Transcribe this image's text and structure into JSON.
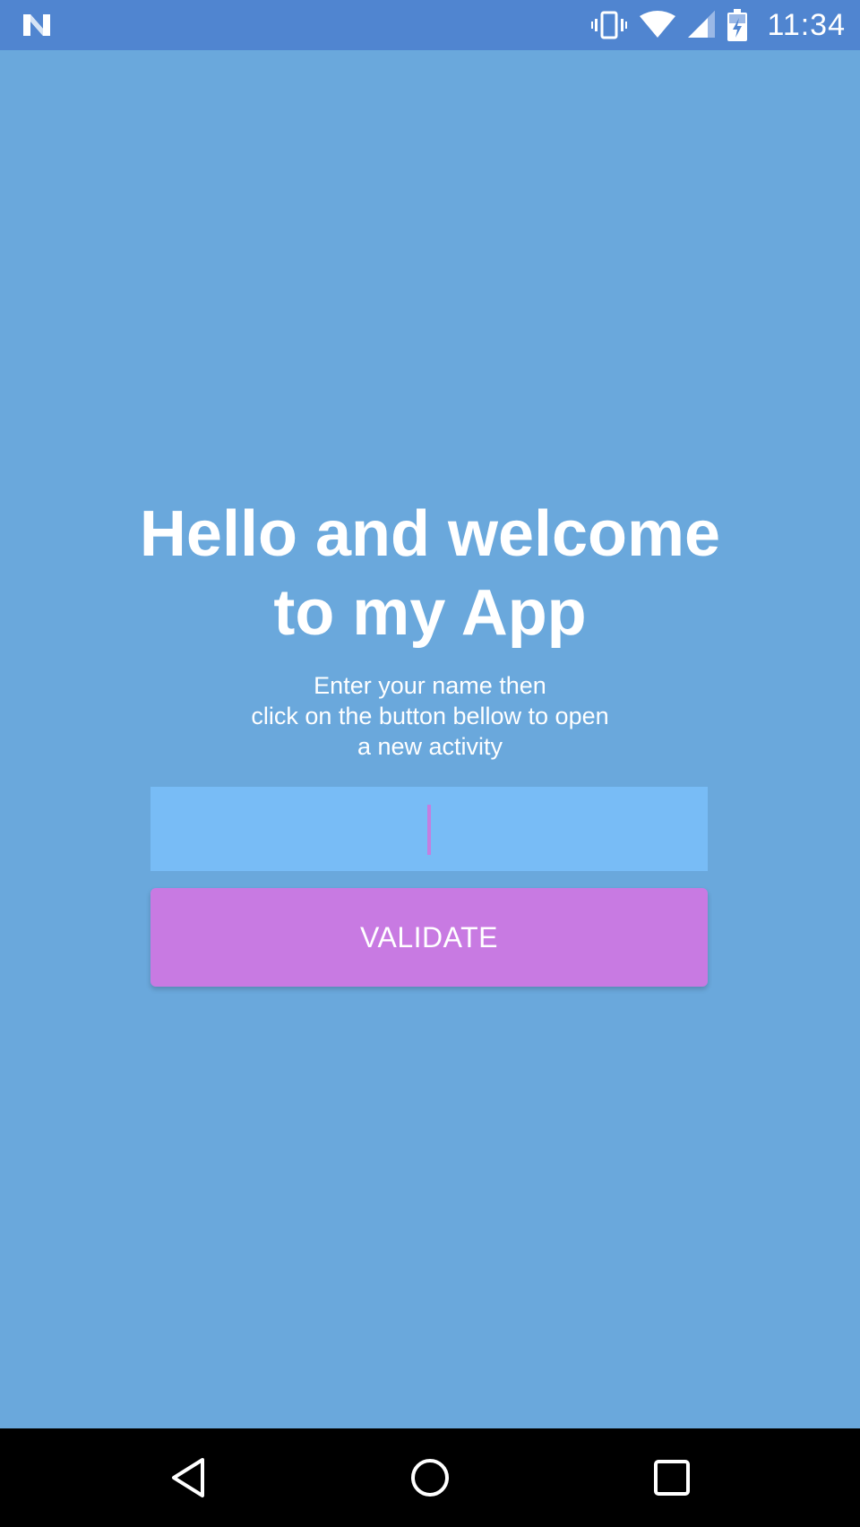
{
  "status_bar": {
    "time": "11:34",
    "logo_icon": "n-logo-icon",
    "icons": [
      "vibrate-icon",
      "wifi-icon",
      "signal-icon",
      "battery-charging-icon"
    ],
    "color": "#5085d0"
  },
  "main": {
    "title_line1": "Hello and welcome",
    "title_line2": "to my App",
    "instructions_line1": "Enter your name then",
    "instructions_line2": "click on the button bellow to open",
    "instructions_line3": "a new activity",
    "name_input": {
      "value": "",
      "placeholder": ""
    },
    "validate_label": "VALIDATE",
    "background_color": "#6aa8dc",
    "input_color": "#78bcf6",
    "button_color": "#c87ae2"
  },
  "nav_bar": {
    "buttons": [
      "back-icon",
      "home-icon",
      "recents-icon"
    ]
  }
}
